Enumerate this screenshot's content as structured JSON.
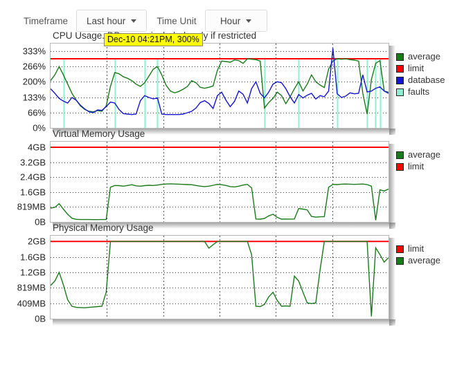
{
  "toolbar": {
    "timeframe_label": "Timeframe",
    "timeframe_value": "Last hour",
    "timeunit_label": "Time Unit",
    "timeunit_value": "Hour"
  },
  "tooltip": {
    "text": "Dec-10 04:21PM, 300%"
  },
  "colors": {
    "average": "#1a7a1a",
    "limit": "#ff0000",
    "database": "#1414d2",
    "faults": "#8ef0d2",
    "grid": "#333333",
    "plot_border": "#b8b8b8"
  },
  "charts": [
    {
      "title": "CPU Usage. DB usage included, only if restricted",
      "yticks": [
        "333%",
        "266%",
        "200%",
        "133%",
        "66%",
        "0%"
      ],
      "legend": [
        {
          "label": "average",
          "color": "#1a7a1a"
        },
        {
          "label": "limit",
          "color": "#ff0000"
        },
        {
          "label": "database",
          "color": "#1414d2"
        },
        {
          "label": "faults",
          "color": "#8ef0d2"
        }
      ]
    },
    {
      "title": "Virtual Memory Usage",
      "yticks": [
        "4GB",
        "3.2GB",
        "2.4GB",
        "1.6GB",
        "819MB",
        "0B"
      ],
      "legend": [
        {
          "label": "average",
          "color": "#1a7a1a"
        },
        {
          "label": "limit",
          "color": "#ff0000"
        }
      ]
    },
    {
      "title": "Physical Memory Usage",
      "yticks": [
        "2GB",
        "1.6GB",
        "1.2GB",
        "819MB",
        "409MB",
        "0B"
      ],
      "legend": [
        {
          "label": "limit",
          "color": "#ff0000"
        },
        {
          "label": "average",
          "color": "#1a7a1a"
        }
      ]
    }
  ],
  "chart_data": [
    {
      "type": "line",
      "title": "CPU Usage. DB usage included, only if restricted",
      "xlabel": "",
      "ylabel": "",
      "ylim": [
        0,
        366
      ],
      "ytick_values": [
        333,
        266,
        200,
        133,
        66,
        0
      ],
      "ytick_labels": [
        "333%",
        "266%",
        "200%",
        "133%",
        "66%",
        "0%"
      ],
      "grid": true,
      "legend_position": "right",
      "series": [
        {
          "name": "limit",
          "color": "#ff0000",
          "values": [
            300,
            300,
            300,
            300,
            300,
            300,
            300,
            300,
            300,
            300,
            300,
            300,
            300,
            300,
            300,
            300,
            300,
            300,
            300,
            300,
            300,
            300,
            300,
            300,
            300,
            300,
            300,
            300,
            300,
            300,
            300,
            300,
            300,
            300,
            300,
            300,
            300,
            300,
            300,
            300,
            300,
            300,
            300,
            300,
            300,
            300,
            300,
            300,
            300,
            300,
            300,
            300,
            300,
            300,
            300,
            300,
            300,
            300,
            300,
            300,
            300,
            300,
            300,
            300,
            300,
            300,
            300,
            300,
            300,
            300,
            300,
            300,
            300,
            300,
            300,
            300,
            300,
            300,
            300,
            300
          ]
        },
        {
          "name": "average",
          "color": "#1a7a1a",
          "values": [
            205,
            230,
            266,
            230,
            190,
            150,
            120,
            95,
            80,
            72,
            70,
            75,
            72,
            95,
            180,
            240,
            235,
            222,
            215,
            205,
            190,
            180,
            196,
            225,
            255,
            266,
            230,
            185,
            160,
            152,
            158,
            168,
            180,
            205,
            196,
            176,
            172,
            176,
            182,
            250,
            290,
            288,
            285,
            295,
            292,
            280,
            300,
            298,
            296,
            290,
            86,
            110,
            128,
            155,
            140,
            105,
            135,
            170,
            200,
            160,
            190,
            230,
            200,
            186,
            175,
            255,
            290,
            300,
            298,
            300,
            296,
            294,
            290,
            150,
            60,
            210,
            280,
            292,
            160,
            155
          ]
        },
        {
          "name": "database",
          "color": "#1414d2",
          "values": [
            170,
            150,
            128,
            116,
            108,
            132,
            120,
            98,
            82,
            70,
            66,
            78,
            76,
            92,
            112,
            108,
            80,
            62,
            60,
            58,
            60,
            118,
            140,
            132,
            126,
            130,
            60,
            58,
            58,
            58,
            58,
            60,
            66,
            72,
            86,
            110,
            118,
            106,
            84,
            140,
            155,
            120,
            92,
            115,
            160,
            146,
            108,
            170,
            200,
            150,
            130,
            155,
            190,
            200,
            196,
            170,
            135,
            108,
            145,
            130,
            142,
            150,
            125,
            140,
            135,
            160,
            345,
            148,
            132,
            138,
            152,
            148,
            150,
            230,
            156,
            160,
            172,
            178,
            160,
            150
          ]
        },
        {
          "name": "faults",
          "color": "#8ef0d2",
          "values": [
            0,
            0,
            0,
            300,
            0,
            0,
            0,
            0,
            0,
            0,
            0,
            0,
            0,
            0,
            0,
            300,
            0,
            0,
            0,
            0,
            0,
            0,
            300,
            0,
            0,
            300,
            0,
            0,
            0,
            0,
            0,
            0,
            0,
            0,
            0,
            0,
            0,
            0,
            0,
            0,
            0,
            0,
            0,
            0,
            0,
            0,
            0,
            0,
            0,
            0,
            300,
            0,
            0,
            0,
            0,
            0,
            0,
            0,
            300,
            0,
            0,
            0,
            0,
            0,
            0,
            0,
            0,
            300,
            0,
            0,
            0,
            0,
            0,
            0,
            300,
            0,
            300,
            300,
            0,
            0
          ]
        }
      ]
    },
    {
      "type": "line",
      "title": "Virtual Memory Usage",
      "xlabel": "",
      "ylabel": "",
      "ylim": [
        0,
        4400
      ],
      "ytick_values": [
        4096,
        3277,
        2458,
        1638,
        819,
        0
      ],
      "ytick_labels": [
        "4GB",
        "3.2GB",
        "2.4GB",
        "1.6GB",
        "819MB",
        "0B"
      ],
      "grid": true,
      "legend_position": "right",
      "series": [
        {
          "name": "limit",
          "color": "#ff0000",
          "values": [
            4096,
            4096,
            4096,
            4096,
            4096,
            4096,
            4096,
            4096,
            4096,
            4096,
            4096,
            4096,
            4096,
            4096,
            4096,
            4096,
            4096,
            4096,
            4096,
            4096,
            4096,
            4096,
            4096,
            4096,
            4096,
            4096,
            4096,
            4096,
            4096,
            4096,
            4096,
            4096,
            4096,
            4096,
            4096,
            4096,
            4096,
            4096,
            4096,
            4096,
            4096,
            4096,
            4096,
            4096,
            4096,
            4096,
            4096,
            4096,
            4096,
            4096,
            4096,
            4096,
            4096,
            4096,
            4096,
            4096,
            4096,
            4096,
            4096,
            4096,
            4096,
            4096,
            4096,
            4096,
            4096,
            4096,
            4096,
            4096,
            4096,
            4096,
            4096,
            4096,
            4096,
            4096,
            4096,
            4096,
            4096,
            4096,
            4096,
            4096
          ]
        },
        {
          "name": "average",
          "color": "#1a7a1a",
          "values": [
            760,
            800,
            1000,
            700,
            420,
            200,
            140,
            130,
            128,
            128,
            126,
            126,
            128,
            130,
            1900,
            2000,
            1990,
            1960,
            2000,
            2040,
            1980,
            1960,
            1990,
            2010,
            2000,
            2020,
            2060,
            2080,
            2090,
            2080,
            2070,
            2060,
            2050,
            2040,
            2000,
            1960,
            1940,
            1960,
            2010,
            2060,
            2040,
            2000,
            1940,
            1920,
            1960,
            2020,
            2060,
            1870,
            160,
            150,
            190,
            330,
            420,
            250,
            150,
            160,
            155,
            160,
            740,
            700,
            660,
            300,
            260,
            280,
            290,
            1900,
            2060,
            2050,
            2070,
            2080,
            2070,
            2060,
            2070,
            2080,
            2050,
            1960,
            90,
            1760,
            1700,
            1800
          ]
        }
      ]
    },
    {
      "type": "line",
      "title": "Physical Memory Usage",
      "xlabel": "",
      "ylabel": "",
      "ylim": [
        0,
        2200
      ],
      "ytick_values": [
        2048,
        1638,
        1229,
        819,
        409,
        0
      ],
      "ytick_labels": [
        "2GB",
        "1.6GB",
        "1.2GB",
        "819MB",
        "409MB",
        "0B"
      ],
      "grid": true,
      "legend_position": "right",
      "series": [
        {
          "name": "limit",
          "color": "#ff0000",
          "values": [
            2048,
            2048,
            2048,
            2048,
            2048,
            2048,
            2048,
            2048,
            2048,
            2048,
            2048,
            2048,
            2048,
            2048,
            2048,
            2048,
            2048,
            2048,
            2048,
            2048,
            2048,
            2048,
            2048,
            2048,
            2048,
            2048,
            2048,
            2048,
            2048,
            2048,
            2048,
            2048,
            2048,
            2048,
            2048,
            2048,
            2048,
            2048,
            2048,
            2048,
            2048,
            2048,
            2048,
            2048,
            2048,
            2048,
            2048,
            2048,
            2048,
            2048,
            2048,
            2048,
            2048,
            2048,
            2048,
            2048,
            2048,
            2048,
            2048,
            2048,
            2048,
            2048,
            2048,
            2048,
            2048,
            2048,
            2048,
            2048,
            2048,
            2048,
            2048,
            2048,
            2048,
            2048,
            2048,
            2048,
            2048,
            2048,
            2048,
            2048
          ]
        },
        {
          "name": "average",
          "color": "#1a7a1a",
          "values": [
            880,
            1000,
            1230,
            900,
            500,
            330,
            300,
            295,
            290,
            300,
            310,
            320,
            330,
            700,
            2048,
            2048,
            2048,
            2048,
            2048,
            2048,
            2048,
            2048,
            2048,
            2048,
            2048,
            2048,
            2048,
            2048,
            2048,
            2048,
            2048,
            2048,
            2048,
            2048,
            2048,
            2048,
            2048,
            1870,
            1960,
            2048,
            2048,
            2048,
            2048,
            2048,
            2048,
            2048,
            2048,
            1700,
            330,
            320,
            380,
            580,
            700,
            480,
            330,
            340,
            330,
            1130,
            1000,
            700,
            420,
            400,
            420,
            1300,
            2048,
            2048,
            2048,
            2048,
            2048,
            2048,
            2048,
            2048,
            2048,
            2048,
            2048,
            60,
            1880,
            1700,
            1500,
            1620
          ]
        }
      ]
    }
  ]
}
